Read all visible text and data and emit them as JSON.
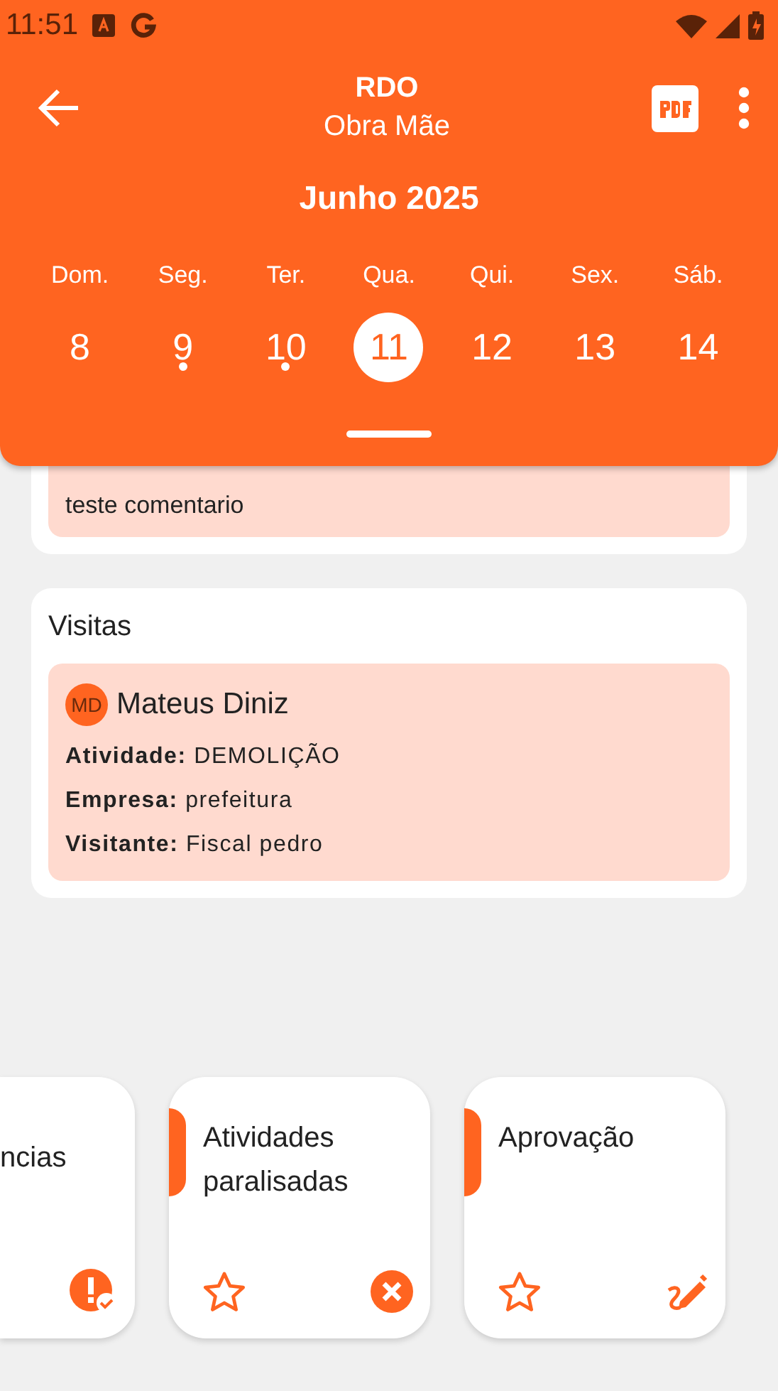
{
  "status_bar": {
    "time": "11:51"
  },
  "app_bar": {
    "title": "RDO",
    "subtitle": "Obra Mãe"
  },
  "calendar": {
    "month": "Junho 2025",
    "days": [
      {
        "weekday": "Dom.",
        "day": "8",
        "selected": false,
        "has_entry": false
      },
      {
        "weekday": "Seg.",
        "day": "9",
        "selected": false,
        "has_entry": true
      },
      {
        "weekday": "Ter.",
        "day": "10",
        "selected": false,
        "has_entry": true
      },
      {
        "weekday": "Qua.",
        "day": "11",
        "selected": true,
        "has_entry": false
      },
      {
        "weekday": "Qui.",
        "day": "12",
        "selected": false,
        "has_entry": false
      },
      {
        "weekday": "Sex.",
        "day": "13",
        "selected": false,
        "has_entry": false
      },
      {
        "weekday": "Sáb.",
        "day": "14",
        "selected": false,
        "has_entry": false
      }
    ]
  },
  "comment": {
    "text": "teste comentario"
  },
  "visits": {
    "title": "Visitas",
    "items": [
      {
        "initials": "MD",
        "name": "Mateus Diniz",
        "fields": [
          "**Atividade:** DEMOLIÇÃO",
          "**Empresa:** prefeitura",
          "**Visitante:** Fiscal pedro"
        ]
      }
    ]
  },
  "shortcuts": [
    {
      "title": "ncias",
      "kind": "warning"
    },
    {
      "title": "Atividades paralisadas",
      "favorite": false,
      "kind": "blocked"
    },
    {
      "title": "Aprovação",
      "favorite": false,
      "kind": "signature"
    }
  ]
}
